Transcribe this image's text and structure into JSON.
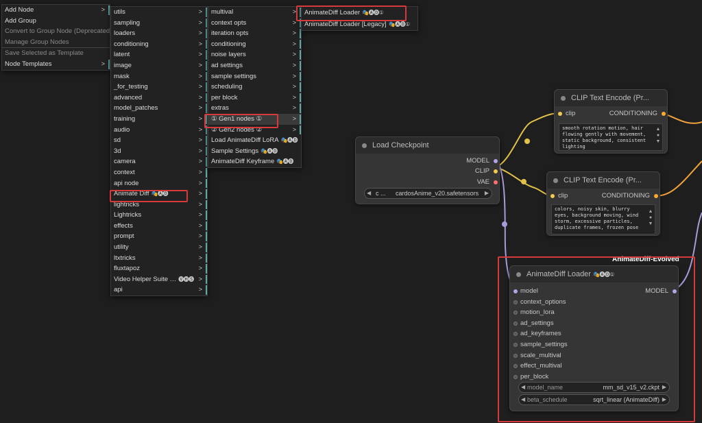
{
  "menus": {
    "root": [
      {
        "label": "Add Node",
        "sub": true
      },
      {
        "label": "Add Group"
      },
      {
        "label": "Convert to Group Node (Deprecated)",
        "disabled": true
      },
      {
        "label": "Manage Group Nodes",
        "disabled": true
      },
      {
        "label": "Save Selected as Template",
        "disabled": true,
        "sep": true
      },
      {
        "label": "Node Templates",
        "sub": true
      }
    ],
    "categories": [
      {
        "label": "utils"
      },
      {
        "label": "sampling"
      },
      {
        "label": "loaders"
      },
      {
        "label": "conditioning"
      },
      {
        "label": "latent"
      },
      {
        "label": "image"
      },
      {
        "label": "mask"
      },
      {
        "label": "_for_testing"
      },
      {
        "label": "advanced"
      },
      {
        "label": "model_patches"
      },
      {
        "label": "training"
      },
      {
        "label": "audio"
      },
      {
        "label": "sd"
      },
      {
        "label": "3d"
      },
      {
        "label": "camera"
      },
      {
        "label": "context"
      },
      {
        "label": "api node"
      },
      {
        "label": "Animate Diff",
        "badge": "🎭🅐🅓"
      },
      {
        "label": "lightricks"
      },
      {
        "label": "Lightricks"
      },
      {
        "label": "effects"
      },
      {
        "label": "prompt"
      },
      {
        "label": "utility"
      },
      {
        "label": "ltxtricks"
      },
      {
        "label": "fluxtapoz"
      },
      {
        "label": "Video Helper Suite …",
        "badge": "🅥🅗🅢"
      },
      {
        "label": "api"
      }
    ],
    "animatediff": [
      {
        "label": "multival",
        "sub": true
      },
      {
        "label": "context opts",
        "sub": true
      },
      {
        "label": "iteration opts",
        "sub": true
      },
      {
        "label": "conditioning",
        "sub": true
      },
      {
        "label": "noise layers",
        "sub": true
      },
      {
        "label": "ad settings",
        "sub": true
      },
      {
        "label": "sample settings",
        "sub": true
      },
      {
        "label": "scheduling",
        "sub": true
      },
      {
        "label": "per block",
        "sub": true
      },
      {
        "label": "extras",
        "sub": true
      },
      {
        "label": "① Gen1 nodes ①",
        "sub": true,
        "hl": true
      },
      {
        "label": "② Gen2 nodes ②",
        "sub": true
      },
      {
        "label": "Load AnimateDiff LoRA",
        "badge": "🎭🅐🅓"
      },
      {
        "label": "Sample Settings",
        "badge": "🎭🅐🅓"
      },
      {
        "label": "AnimateDiff Keyframe",
        "badge": "🎭🅐🅓"
      }
    ],
    "gen1": [
      {
        "label": "AnimateDiff Loader",
        "badge": "🎭🅐🅓①"
      },
      {
        "label": "AnimateDiff Loader [Legacy]",
        "badge": "🎭🅐🅓①"
      }
    ]
  },
  "nodes": {
    "clip1": {
      "title": "CLIP Text Encode (Pr...",
      "input": "clip",
      "output": "CONDITIONING",
      "text": "smooth rotation motion, hair flowing gently with movement, static background, consistent lighting"
    },
    "clip2": {
      "title": "CLIP Text Encode (Pr...",
      "input": "clip",
      "output": "CONDITIONING",
      "text": "colors, noisy skin, blurry eyes, background moving, wind storm, excessive particles, duplicate frames, frozen pose"
    },
    "checkpoint": {
      "title": "Load Checkpoint",
      "outputs": [
        "MODEL",
        "CLIP",
        "VAE"
      ],
      "ckpt_prefix": "c ...",
      "ckpt_name": "cardosAnime_v20.safetensors"
    },
    "loader": {
      "group_label": "AnimateDiff-Evolved",
      "title": "AnimateDiff Loader",
      "title_badge": "🎭🅐🅓①",
      "inputs": [
        "model",
        "context_options",
        "motion_lora",
        "ad_settings",
        "ad_keyframes",
        "sample_settings",
        "scale_multival",
        "effect_multival",
        "per_block"
      ],
      "output": "MODEL",
      "widgets": [
        {
          "name": "model_name",
          "value": "mm_sd_v15_v2.ckpt"
        },
        {
          "name": "beta_schedule",
          "value": "sqrt_linear (AnimateDiff)"
        }
      ]
    }
  },
  "colors": {
    "clip": "#f2c94c",
    "model": "#b3a4e6",
    "vae": "#ff6e6e",
    "conditioning": "#ffa931",
    "highlight": "#d63a3a"
  }
}
